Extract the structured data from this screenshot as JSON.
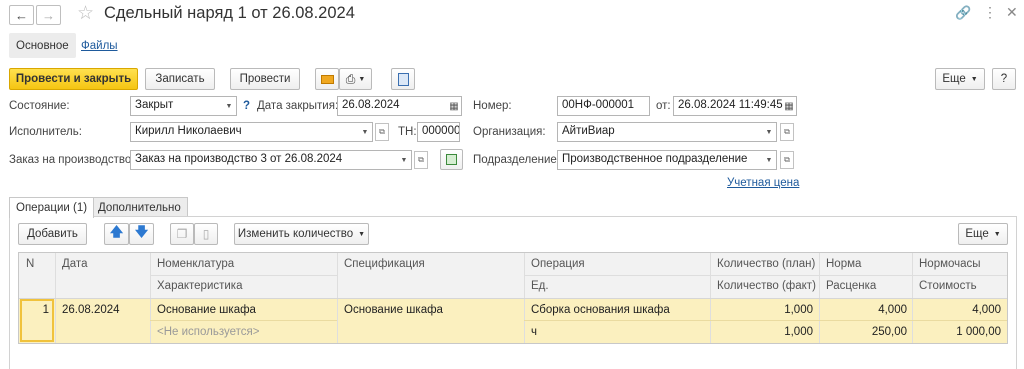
{
  "window": {
    "title": "Сдельный наряд 1 от 26.08.2024"
  },
  "top_tabs": {
    "main": "Основное",
    "files": "Файлы"
  },
  "toolbar": {
    "post_close": "Провести и закрыть",
    "save": "Записать",
    "post": "Провести",
    "more": "Еще",
    "help": "?"
  },
  "form": {
    "state_label": "Состояние:",
    "state_value": "Закрыт",
    "state_help": "?",
    "close_date_label": "Дата закрытия:",
    "close_date_value": "26.08.2024",
    "number_label": "Номер:",
    "number_value": "00НФ-000001",
    "from_label": "от:",
    "from_value": "26.08.2024 11:49:45",
    "executor_label": "Исполнитель:",
    "executor_value": "Кирилл Николаевич",
    "tn_label": "ТН:",
    "tn_value": "000000",
    "org_label": "Организация:",
    "org_value": "АйтиВиар",
    "order_label": "Заказ на производство:",
    "order_value": "Заказ на производство 3 от 26.08.2024",
    "dept_label": "Подразделение:",
    "dept_value": "Производственное подразделение",
    "price_link": "Учетная цена"
  },
  "tabs": {
    "operations": "Операции (1)",
    "extra": "Дополнительно"
  },
  "table_toolbar": {
    "add": "Добавить",
    "change_qty": "Изменить количество",
    "more": "Еще"
  },
  "table": {
    "headers": {
      "n": "N",
      "date": "Дата",
      "nomenclature": "Номенклатура",
      "characteristic": "Характеристика",
      "specification": "Спецификация",
      "operation": "Операция",
      "unit": "Ед.",
      "qty_plan": "Количество (план)",
      "qty_fact": "Количество (факт)",
      "norm": "Норма",
      "rate": "Расценка",
      "norm_hours": "Нормочасы",
      "cost": "Стоимость"
    },
    "rows": [
      {
        "n": "1",
        "date": "26.08.2024",
        "nomenclature": "Основание шкафа",
        "characteristic": "<Не используется>",
        "specification": "Основание шкафа",
        "operation": "Сборка основания шкафа",
        "unit": "ч",
        "qty_plan": "1,000",
        "qty_fact": "1,000",
        "norm": "4,000",
        "rate": "250,00",
        "norm_hours": "4,000",
        "cost": "1 000,00"
      }
    ]
  },
  "colors": {
    "accent_yellow": "#f5c512",
    "row_highlight": "#fbf0bf",
    "link_blue": "#1e5a9c"
  }
}
